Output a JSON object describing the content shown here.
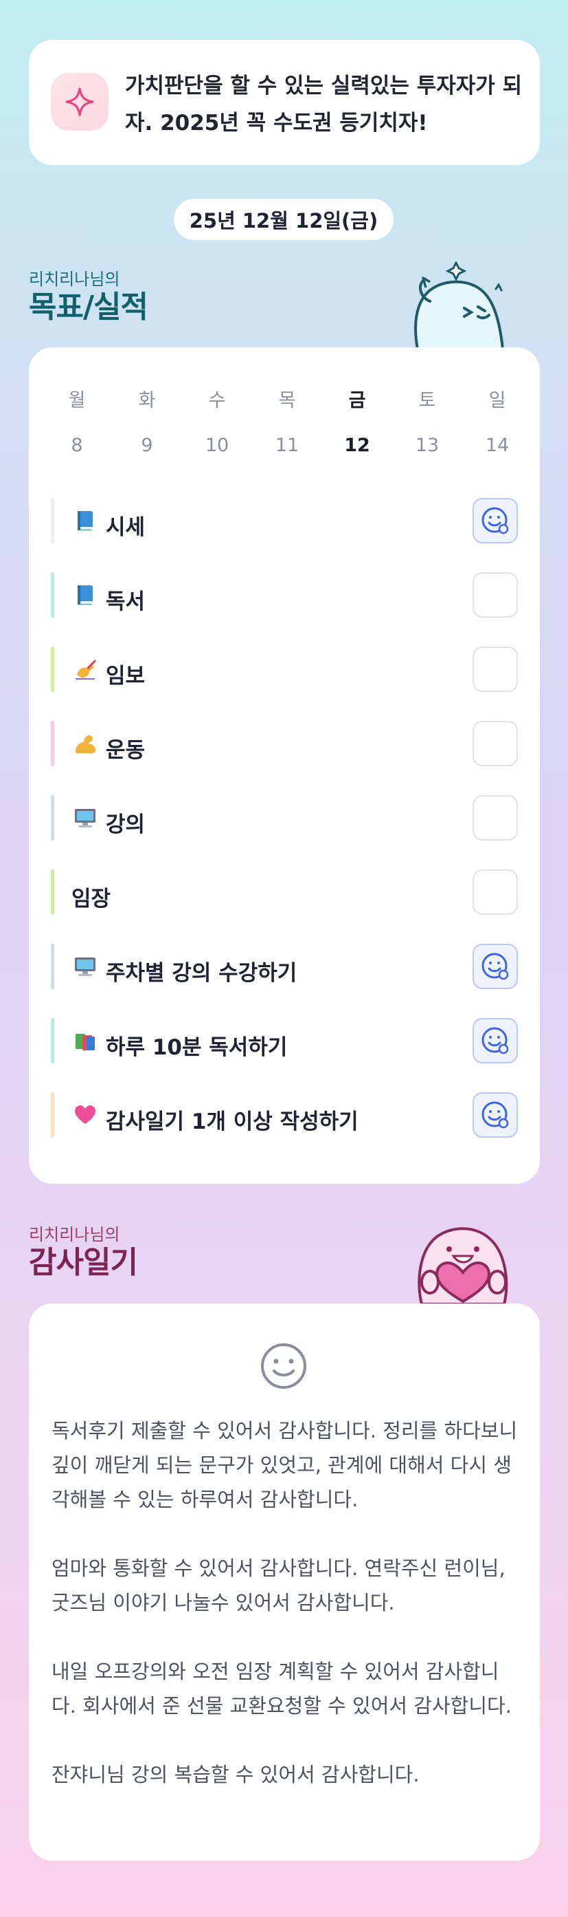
{
  "goal_banner": {
    "icon": "sparkle-icon",
    "text": "가치판단을 할 수 있는 실력있는 투자자가 되자. 2025년 꼭 수도권 등기치자!"
  },
  "date_label": "25년 12월 12일(금)",
  "goals_section": {
    "subtitle": "리치리나님의",
    "title": "목표/실적"
  },
  "week": {
    "days": [
      "월",
      "화",
      "수",
      "목",
      "금",
      "토",
      "일"
    ],
    "dates": [
      "8",
      "9",
      "10",
      "11",
      "12",
      "13",
      "14"
    ],
    "selected_index": 4
  },
  "tasks": [
    {
      "emoji": "blue-book-icon",
      "label": "시세",
      "bar_color": "#eceef2",
      "done": true
    },
    {
      "emoji": "blue-book-icon",
      "label": "독서",
      "bar_color": "#b9ecdf",
      "done": false
    },
    {
      "emoji": "writing-hand-icon",
      "label": "임보",
      "bar_color": "#d3ec9f",
      "done": false
    },
    {
      "emoji": "flexed-biceps-icon",
      "label": "운동",
      "bar_color": "#f8cbe0",
      "done": false
    },
    {
      "emoji": "computer-icon",
      "label": "강의",
      "bar_color": "#cfdbef",
      "done": false
    },
    {
      "emoji": "",
      "label": "임장",
      "bar_color": "#cdeea0",
      "done": false
    },
    {
      "emoji": "computer-icon",
      "label": "주차별 강의 수강하기",
      "bar_color": "#cfdbef",
      "done": true
    },
    {
      "emoji": "books-icon",
      "label": "하루 10분 독서하기",
      "bar_color": "#b9ecdf",
      "done": true
    },
    {
      "emoji": "pink-heart-icon",
      "label": "감사일기 1개 이상 작성하기",
      "bar_color": "#fbe1bd",
      "done": true
    }
  ],
  "gratitude_section": {
    "subtitle": "리치리나님의",
    "title": "감사일기",
    "mood_icon": "smile-face-icon",
    "paragraphs": [
      "독서후기 제출할 수 있어서 감사합니다. 정리를 하다보니 깊이 깨닫게 되는 문구가 있엇고, 관계에 대해서 다시 생각해볼 수 있는 하루여서 감사합니다.",
      "엄마와 통화할 수 있어서 감사합니다. 연락주신 런이님, 굿즈님 이야기 나눌수 있어서 감사합니다.",
      "내일 오프강의와 오전 임장 계획할 수 있어서 감사합니다. 회사에서 준 선물 교환요청할 수 있어서 감사합니다.",
      "잔쟈니님 강의 복습할 수 있어서 감사합니다."
    ]
  },
  "colors": {
    "teal_title": "#11606a",
    "magenta_title": "#7d2452",
    "check_done_border": "#b9c8f3",
    "check_done_icon": "#3f63e0"
  }
}
